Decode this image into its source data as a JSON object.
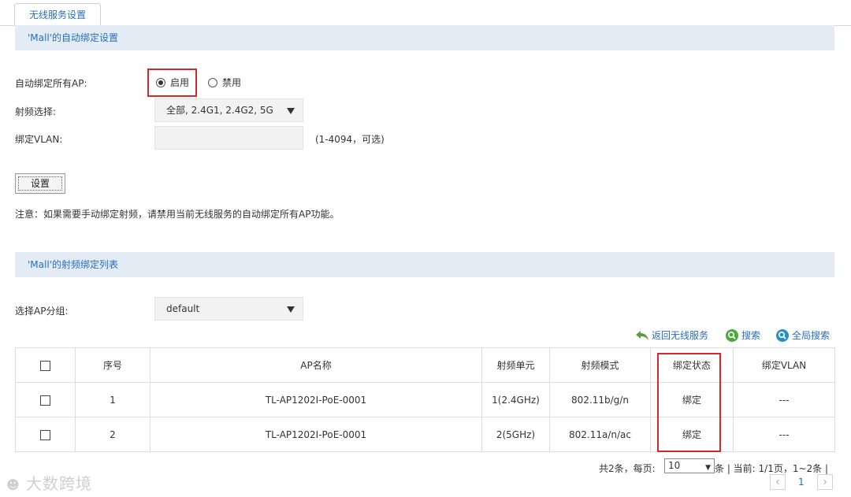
{
  "tab": {
    "label": "无线服务设置"
  },
  "auto_bind": {
    "section_title": "'Mall'的自动绑定设置",
    "bind_all_label": "自动绑定所有AP:",
    "radio_enable": "启用",
    "radio_disable": "禁用",
    "selected": "enable",
    "band_label": "射频选择:",
    "band_value": "全部, 2.4G1, 2.4G2, 5G",
    "vlan_label": "绑定VLAN:",
    "vlan_value": "",
    "vlan_hint": "(1-4094，可选)",
    "set_button": "设置",
    "note": "注意：如果需要手动绑定射频，请禁用当前无线服务的自动绑定所有AP功能。"
  },
  "bind_list": {
    "section_title": "'Mall'的射频绑定列表",
    "group_label": "选择AP分组:",
    "group_value": "default",
    "toolbar": {
      "back": "返回无线服务",
      "search": "搜索",
      "global_search": "全局搜索"
    },
    "columns": [
      "序号",
      "AP名称",
      "射频单元",
      "射频模式",
      "绑定状态",
      "绑定VLAN"
    ],
    "rows": [
      {
        "index": "1",
        "ap_name": "TL-AP1202I-PoE-0001",
        "radio_unit": "1(2.4GHz)",
        "radio_mode": "802.11b/g/n",
        "status": "绑定",
        "vlan": "---"
      },
      {
        "index": "2",
        "ap_name": "TL-AP1202I-PoE-0001",
        "radio_unit": "2(5GHz)",
        "radio_mode": "802.11a/n/ac",
        "status": "绑定",
        "vlan": "---"
      }
    ]
  },
  "pagination": {
    "total": "共2条，每页:",
    "per_page": "10",
    "status": "条 | 当前: 1/1页，1~2条 |",
    "current_page": "1",
    "prev": "‹",
    "next": "›"
  },
  "watermark": "大数跨境",
  "colors": {
    "accent": "#2a6ebb",
    "section_bg": "#e3ecf5",
    "highlight": "#d62828"
  }
}
